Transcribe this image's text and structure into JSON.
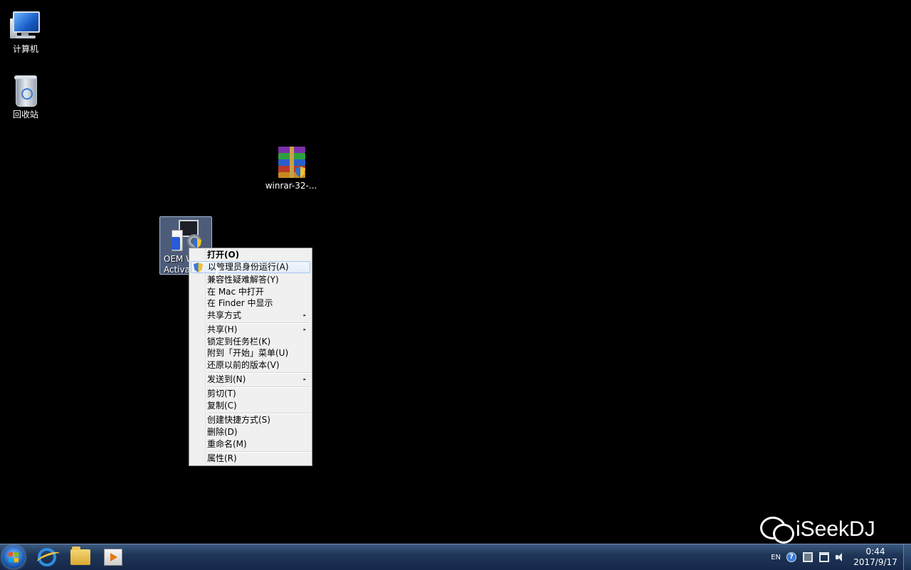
{
  "desktop_icons": {
    "computer": {
      "label": "计算机"
    },
    "recycle_bin": {
      "label": "回收站"
    },
    "winrar": {
      "label": "winrar-32-..."
    },
    "oem": {
      "label_line1": "OEM W",
      "label_line2": "Activa"
    }
  },
  "context_menu": {
    "items": [
      {
        "label": "打开(O)"
      },
      {
        "label": "以管理员身份运行(A)"
      },
      {
        "label": "兼容性疑难解答(Y)"
      },
      {
        "label": "在 Mac 中打开"
      },
      {
        "label": "在 Finder 中显示"
      },
      {
        "label": "共享方式"
      },
      {
        "label": "共享(H)"
      },
      {
        "label": "锁定到任务栏(K)"
      },
      {
        "label": "附到「开始」菜单(U)"
      },
      {
        "label": "还原以前的版本(V)"
      },
      {
        "label": "发送到(N)"
      },
      {
        "label": "剪切(T)"
      },
      {
        "label": "复制(C)"
      },
      {
        "label": "创建快捷方式(S)"
      },
      {
        "label": "删除(D)"
      },
      {
        "label": "重命名(M)"
      },
      {
        "label": "属性(R)"
      }
    ],
    "submenu_arrow": "▸"
  },
  "watermark": {
    "text": "iSeekDJ"
  },
  "taskbar": {
    "tray": {
      "language": "EN",
      "help_glyph": "?",
      "time": "0:44",
      "date": "2017/9/17"
    }
  },
  "colors": {
    "desktop_bg": "#000000",
    "menu_bg": "#f0f0f0",
    "taskbar_bg": "#1e3657",
    "selection": "#8caadc"
  }
}
